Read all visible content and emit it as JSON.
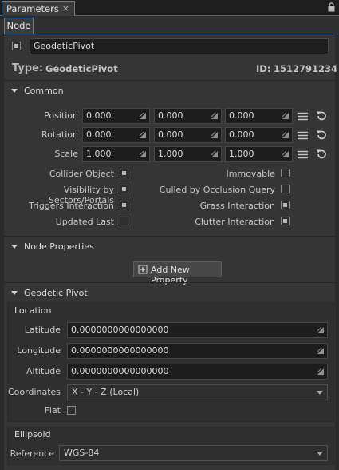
{
  "panel": {
    "tab_label": "Parameters",
    "close_glyph": "×"
  },
  "subtab": {
    "label": "Node"
  },
  "node": {
    "name_value": "GeodeticPivot",
    "type_label": "Type:",
    "type_value": "GeodeticPivot",
    "id_label": "ID:",
    "id_value": "1512791234"
  },
  "common": {
    "title": "Common",
    "rows": [
      {
        "label": "Position",
        "values": [
          "0.000",
          "0.000",
          "0.000"
        ]
      },
      {
        "label": "Rotation",
        "values": [
          "0.000",
          "0.000",
          "0.000"
        ]
      },
      {
        "label": "Scale",
        "values": [
          "1.000",
          "1.000",
          "1.000"
        ]
      }
    ],
    "flags_left": [
      {
        "label": "Collider Object",
        "checked": true
      },
      {
        "label": "Visibility by Sectors/Portals",
        "checked": true
      },
      {
        "label": "Triggers Interaction",
        "checked": true
      },
      {
        "label": "Updated Last",
        "checked": false
      }
    ],
    "flags_right": [
      {
        "label": "Immovable",
        "checked": false
      },
      {
        "label": "Culled by Occlusion Query",
        "checked": false
      },
      {
        "label": "Grass Interaction",
        "checked": true
      },
      {
        "label": "Clutter Interaction",
        "checked": true
      }
    ]
  },
  "node_properties": {
    "title": "Node Properties",
    "add_button": "Add New Property"
  },
  "geodetic": {
    "title": "Geodetic Pivot",
    "location_title": "Location",
    "latitude_label": "Latitude",
    "latitude_value": "0.0000000000000000",
    "longitude_label": "Longitude",
    "longitude_value": "0.0000000000000000",
    "altitude_label": "Altitude",
    "altitude_value": "0.0000000000000000",
    "coordinates_label": "Coordinates",
    "coordinates_value": "X - Y - Z (Local)",
    "flat_label": "Flat",
    "flat_checked": false,
    "ellipsoid_title": "Ellipsoid",
    "reference_label": "Reference",
    "reference_value": "WGS-84"
  },
  "icons": [
    "lock-icon",
    "collapse-triangle-icon",
    "drag-grip-icon",
    "menu-lines-icon",
    "reset-icon",
    "add-property-icon",
    "dropdown-arrow-icon"
  ]
}
